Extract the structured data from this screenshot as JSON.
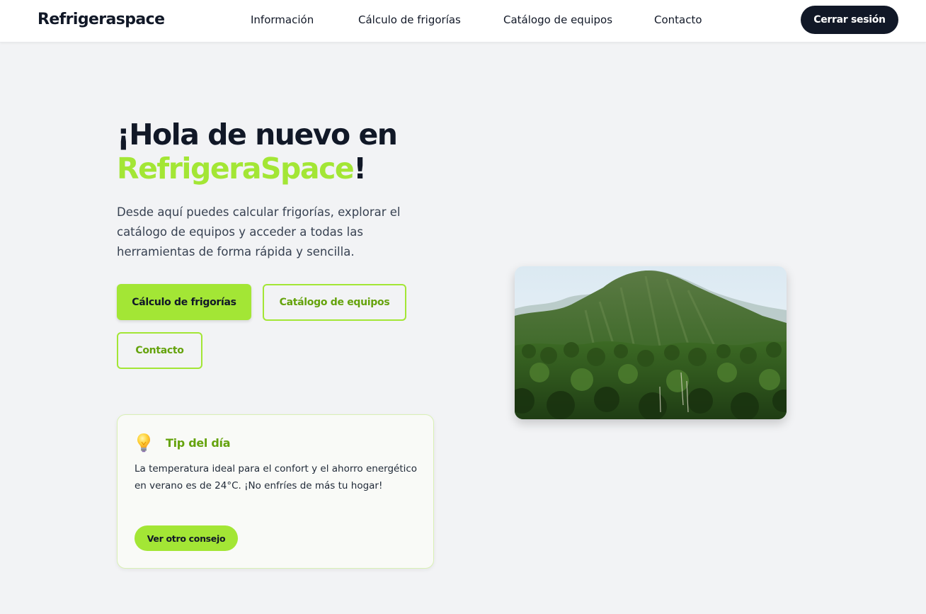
{
  "brand": "Refrigeraspace",
  "nav": {
    "links": [
      "Información",
      "Cálculo de frigorías",
      "Catálogo de equipos",
      "Contacto"
    ],
    "logout_label": "Cerrar sesión"
  },
  "hero": {
    "title_line1": "¡Hola de nuevo en",
    "title_accent": "RefrigeraSpace",
    "title_end": "!",
    "description": "Desde aquí puedes calcular frigorías, explorar el catálogo de equipos y acceder a todas las herramientas de forma rápida y sencilla.",
    "buttons": {
      "primary": "Cálculo de frigorías",
      "catalog": "Catálogo de equipos",
      "contact": "Contacto"
    },
    "image_icon": "mountain-landscape-photo"
  },
  "tip": {
    "icon": "lightbulb-icon",
    "title": "Tip del día",
    "text": "La temperatura ideal para el confort y el ahorro energético en verano es de 24°C. ¡No enfríes de más tu hogar!",
    "button_label": "Ver otro consejo"
  },
  "colors": {
    "accent": "#a3e635",
    "accent_dark": "#65a30d",
    "dark": "#111827",
    "background": "#f2f3f5"
  }
}
